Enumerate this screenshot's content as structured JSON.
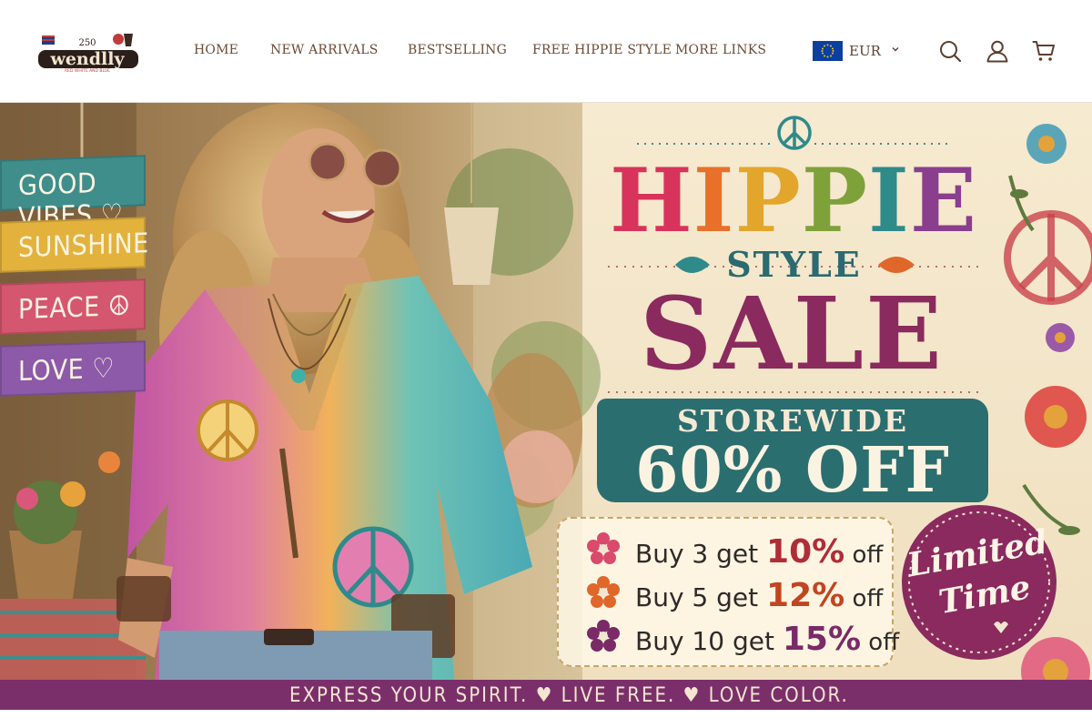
{
  "brand": {
    "logo_text": "wendlly",
    "logo_badge": "250",
    "logo_tagline": "RED WHITE AND BLUE"
  },
  "nav": {
    "items": [
      {
        "label": "HOME"
      },
      {
        "label": "NEW ARRIVALS"
      },
      {
        "label": "BESTSELLING"
      },
      {
        "label": "FREE HIPPIE STYLE"
      },
      {
        "label": "MORE LINKS"
      }
    ]
  },
  "currency": {
    "label": "EUR",
    "flag_icon": "eu-flag-icon"
  },
  "header_icons": [
    "search-icon",
    "account-icon",
    "cart-icon"
  ],
  "banner": {
    "signs": [
      {
        "label": "GOOD VIBES ♡",
        "color": "#3f8e8c"
      },
      {
        "label": "SUNSHINE",
        "color": "#e3b23c"
      },
      {
        "label": "PEACE ☮",
        "color": "#d4566f"
      },
      {
        "label": "LOVE ♡",
        "color": "#8c5aa8"
      }
    ],
    "title_letters": [
      {
        "ch": "H",
        "color": "#d8335b"
      },
      {
        "ch": "I",
        "color": "#e8702a"
      },
      {
        "ch": "P",
        "color": "#e3a62c"
      },
      {
        "ch": "P",
        "color": "#7fa13a"
      },
      {
        "ch": "I",
        "color": "#2f8a8a"
      },
      {
        "ch": "E",
        "color": "#8a3e8e"
      }
    ],
    "title_style": "STYLE",
    "title_sale": "SALE",
    "storewide": "STOREWIDE",
    "discount": "60% OFF",
    "deals": [
      {
        "prefix": "Buy 3 get ",
        "pct": "10%",
        "suffix": " off",
        "flower_color": "#d94a6c"
      },
      {
        "prefix": "Buy 5 get ",
        "pct": "12%",
        "suffix": " off",
        "flower_color": "#e0672a"
      },
      {
        "prefix": "Buy 10 get ",
        "pct": "15%",
        "suffix": " off",
        "flower_color": "#7a2a66"
      }
    ],
    "limited_line1": "Limited",
    "limited_line2": "Time",
    "ribbon_text": "EXPRESS YOUR SPIRIT. ♥ LIVE FREE. ♥ LOVE COLOR.",
    "colors": {
      "teal": "#2b6e70",
      "plum": "#8a2a5e",
      "ribbon": "#7a2f6a",
      "cream": "#f6ecd6"
    }
  }
}
